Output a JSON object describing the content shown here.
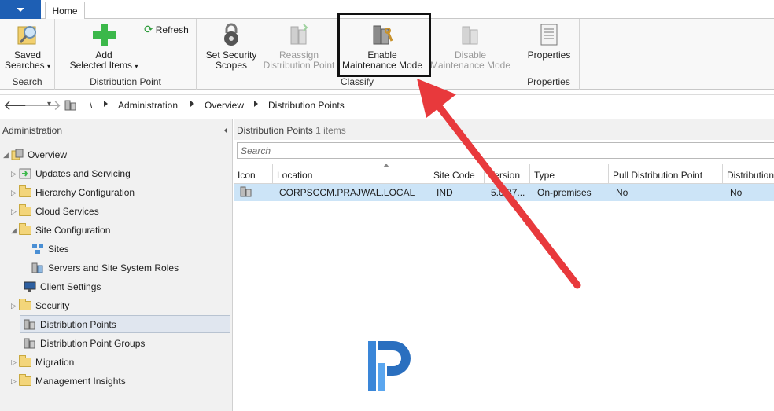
{
  "tabs": {
    "home": "Home"
  },
  "ribbon": {
    "search_group": {
      "label": "Search",
      "saved_searches": "Saved",
      "saved_searches2": "Searches"
    },
    "dp_group": {
      "label": "Distribution Point",
      "add_line1": "Add",
      "add_line2": "Selected Items",
      "refresh": "Refresh"
    },
    "classify_group": {
      "label": "Classify",
      "set_security_1": "Set Security",
      "set_security_2": "Scopes",
      "reassign_1": "Reassign",
      "reassign_2": "Distribution Point",
      "enable_1": "Enable",
      "enable_2": "Maintenance Mode",
      "disable_1": "Disable",
      "disable_2": "Maintenance Mode"
    },
    "props_group": {
      "label": "Properties",
      "properties": "Properties"
    }
  },
  "address": {
    "root": "\\",
    "crumbs": [
      "Administration",
      "Overview",
      "Distribution Points"
    ]
  },
  "nav": {
    "title": "Administration",
    "items": [
      {
        "label": "Overview"
      },
      {
        "label": "Updates and Servicing"
      },
      {
        "label": "Hierarchy Configuration"
      },
      {
        "label": "Cloud Services"
      },
      {
        "label": "Site Configuration"
      },
      {
        "label": "Sites"
      },
      {
        "label": "Servers and Site System Roles"
      },
      {
        "label": "Client Settings"
      },
      {
        "label": "Security"
      },
      {
        "label": "Distribution Points"
      },
      {
        "label": "Distribution Point Groups"
      },
      {
        "label": "Migration"
      },
      {
        "label": "Management Insights"
      }
    ]
  },
  "content": {
    "title": "Distribution Points",
    "count": "1 items",
    "search_placeholder": "Search",
    "columns": [
      "Icon",
      "Location",
      "Site Code",
      "Version",
      "Type",
      "Pull Distribution Point",
      "Distribution"
    ],
    "rows": [
      {
        "location": "CORPSCCM.PRAJWAL.LOCAL",
        "site_code": "IND",
        "version": "5.0.87...",
        "type": "On-premises",
        "pull": "No",
        "dist": "No"
      }
    ]
  },
  "colors": {
    "accent": "#1e5fb4",
    "selection": "#cce4f7",
    "arrow": "#e8393c",
    "folder": "#f3d57a"
  }
}
